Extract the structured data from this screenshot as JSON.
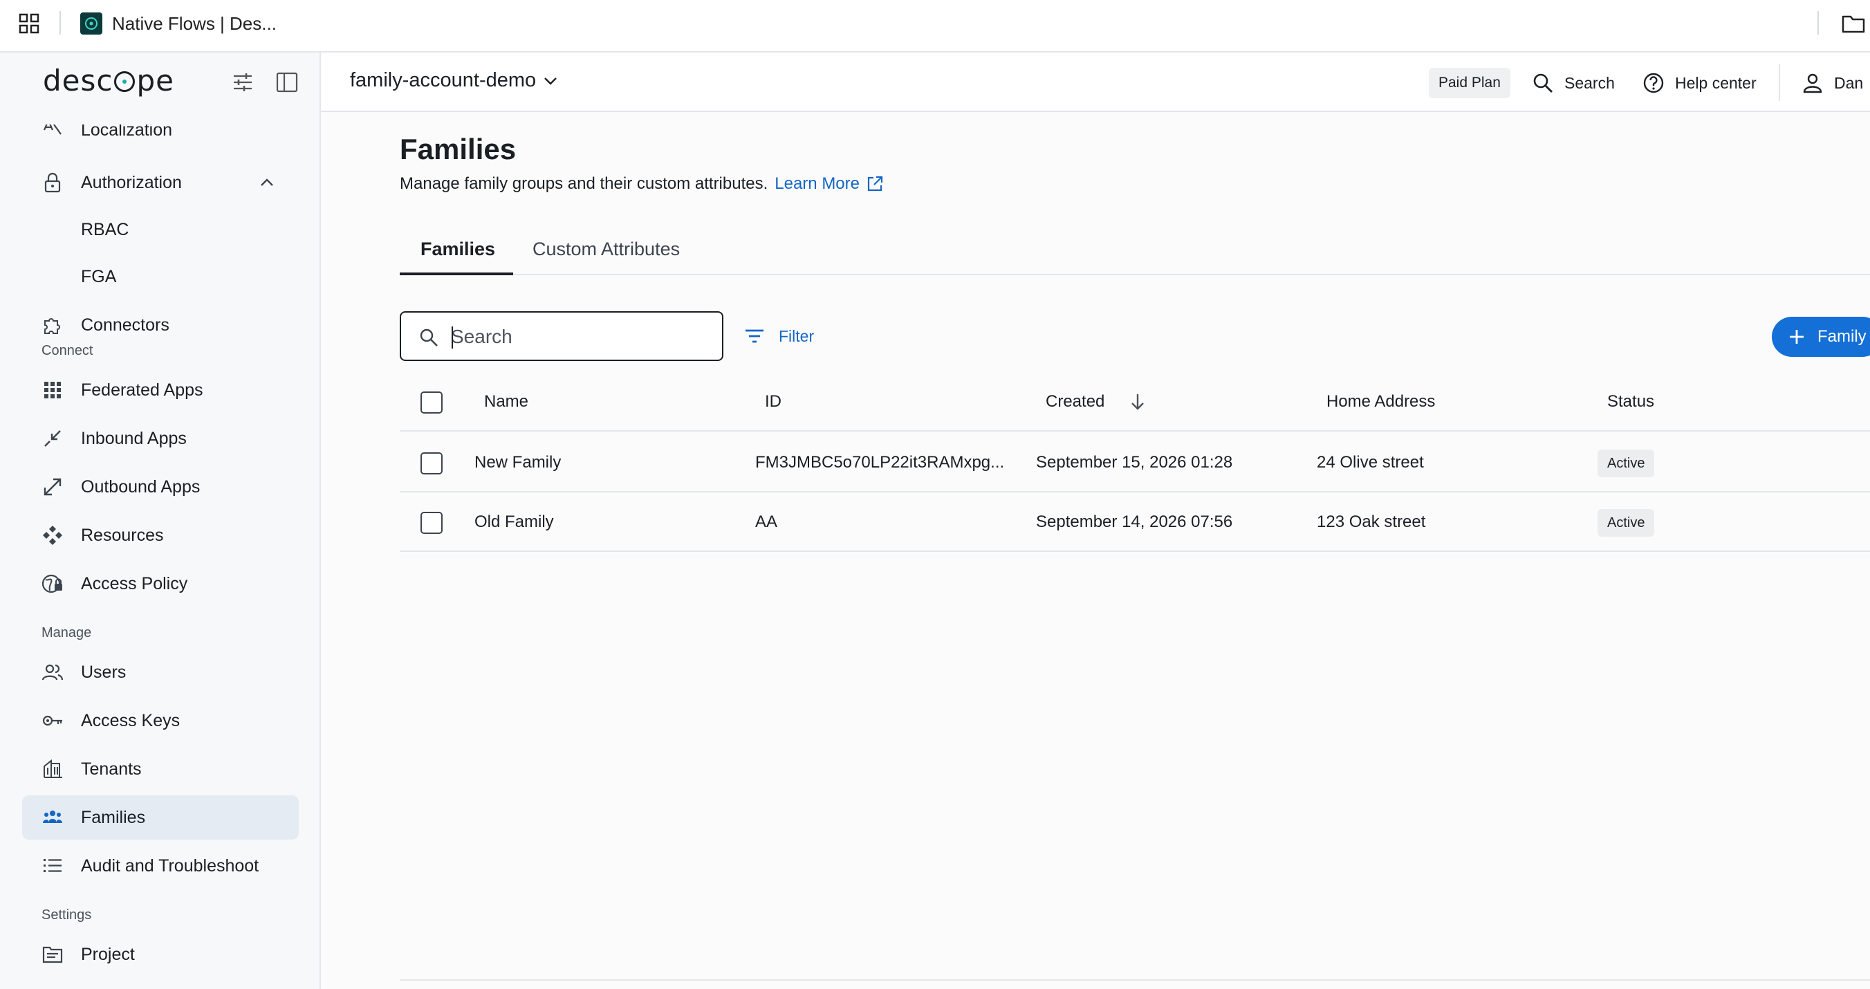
{
  "browser": {
    "tab_title": "Native Flows | Des..."
  },
  "brand": {
    "logo_prefix": "desc",
    "logo_suffix": "pe",
    "accent": "#18b0a8"
  },
  "sidebar": {
    "items": [
      {
        "label": "Localization",
        "icon": "translate-icon"
      },
      {
        "label": "Authorization",
        "icon": "lock-icon"
      },
      {
        "label": "RBAC"
      },
      {
        "label": "FGA"
      },
      {
        "label": "Connectors",
        "icon": "puzzle-icon"
      },
      {
        "label": "Federated Apps",
        "icon": "apps-grid-icon"
      },
      {
        "label": "Inbound Apps",
        "icon": "arrow-inbound-icon"
      },
      {
        "label": "Outbound Apps",
        "icon": "arrow-outbound-icon"
      },
      {
        "label": "Resources",
        "icon": "resources-icon"
      },
      {
        "label": "Access Policy",
        "icon": "globe-lock-icon"
      },
      {
        "label": "Users",
        "icon": "users-icon"
      },
      {
        "label": "Access Keys",
        "icon": "key-icon"
      },
      {
        "label": "Tenants",
        "icon": "building-icon"
      },
      {
        "label": "Families",
        "icon": "family-icon"
      },
      {
        "label": "Audit and Troubleshoot",
        "icon": "list-icon"
      },
      {
        "label": "Project",
        "icon": "project-icon"
      }
    ],
    "sections": {
      "connect": "Connect",
      "manage": "Manage",
      "settings": "Settings"
    },
    "active_color": "#e4ebf3"
  },
  "header": {
    "project": "family-account-demo",
    "plan": "Paid Plan",
    "search": "Search",
    "help": "Help center",
    "user": "Dan"
  },
  "page": {
    "title": "Families",
    "description": "Manage family groups and their custom attributes.",
    "learn_more": "Learn More",
    "tabs": [
      "Families",
      "Custom Attributes"
    ],
    "active_tab": "Families",
    "search_placeholder": "Search",
    "filter": "Filter",
    "add_button": "Family",
    "link_color": "#1366c4",
    "primary_color": "#1470d6"
  },
  "table": {
    "columns": [
      "Name",
      "ID",
      "Created",
      "Home Address",
      "Status"
    ],
    "rows": [
      {
        "name": "New Family",
        "id": "FM3JMBC5o70LP22it3RAMxpg...",
        "created": "September 15, 2026 01:28",
        "address": "24 Olive street",
        "status": "Active"
      },
      {
        "name": "Old Family",
        "id": "AA",
        "created": "September 14, 2026 07:56",
        "address": "123 Oak street",
        "status": "Active"
      }
    ]
  }
}
